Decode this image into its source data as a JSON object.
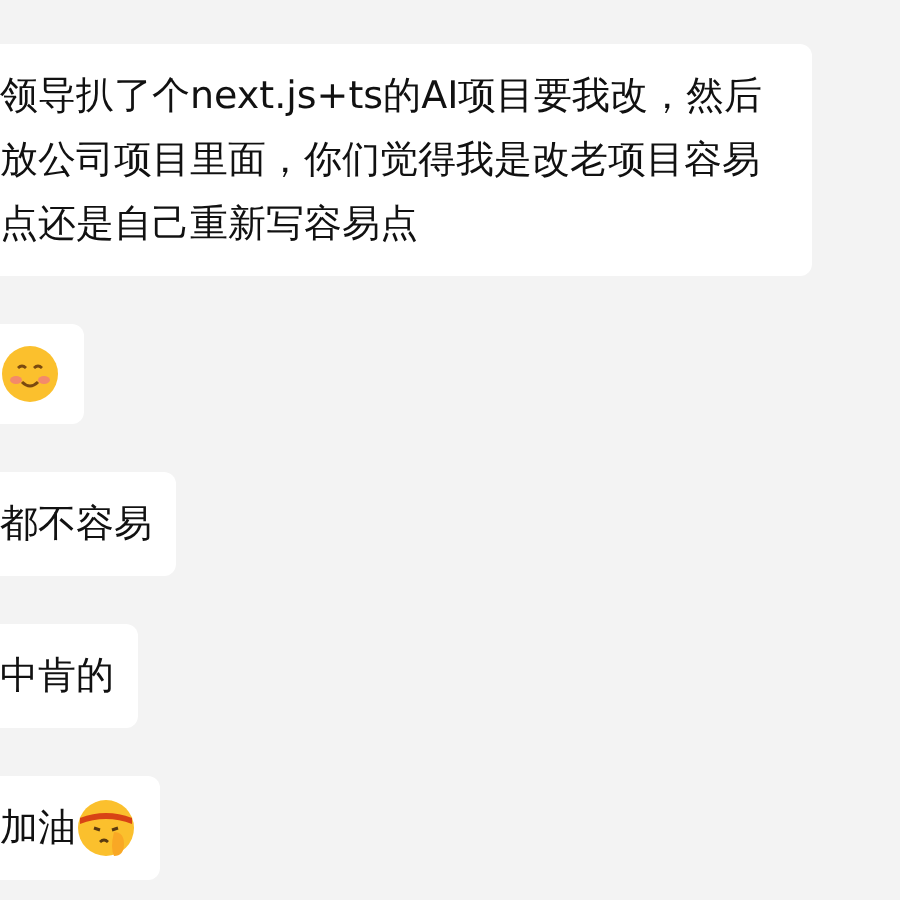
{
  "messages": [
    {
      "text": "领导扒了个next.js+ts的AI项目要我改，然后放公司项目里面，你们觉得我是改老项目容易点还是自己重新写容易点",
      "kind": "plain"
    },
    {
      "kind": "smile"
    },
    {
      "text": "都不容易",
      "kind": "plain"
    },
    {
      "text": "中肯的",
      "kind": "plain"
    },
    {
      "text": "加油",
      "kind": "headband"
    }
  ]
}
